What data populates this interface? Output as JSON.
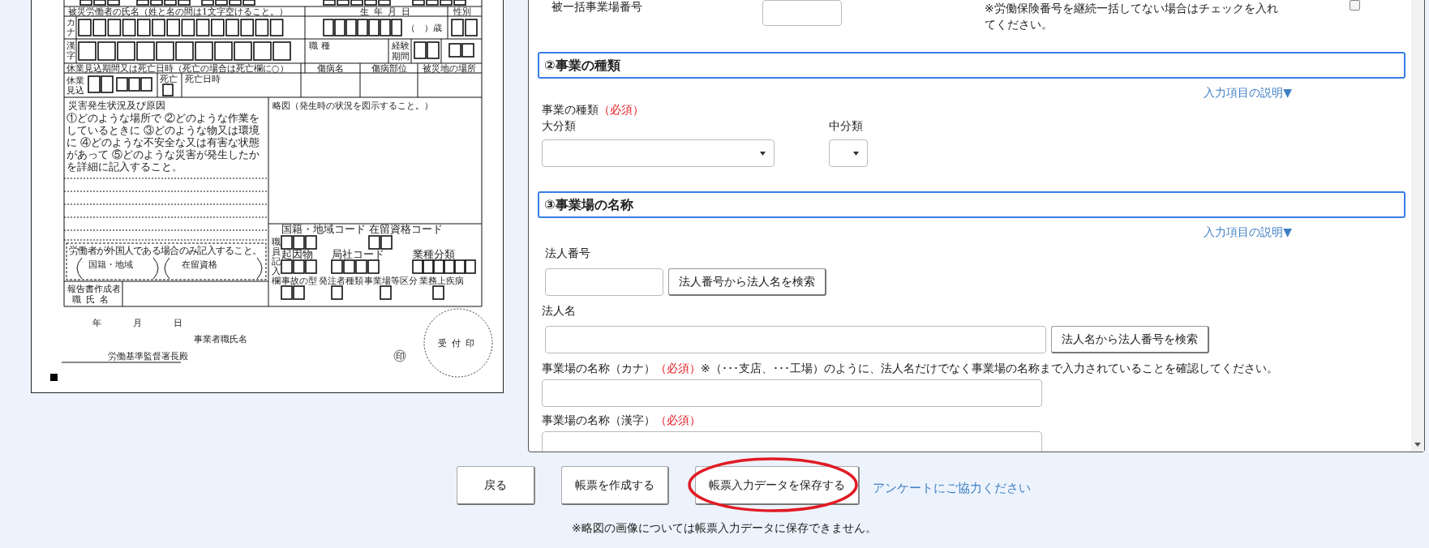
{
  "form_preview": {
    "name_header": "被災労働者の氏名（姓と名の間は1文字空けること。）",
    "birth_header": "生年月日",
    "sex_header": "性別",
    "kana_label": "カナ",
    "kanji_label": "漢字",
    "age_text": "（　）歳",
    "occupation_label": "職種",
    "experience_label": "経験期間",
    "absence_header": "休業見込期間又は死亡日時（死亡の場合は死亡欄に○）",
    "injury_header": "傷病名",
    "body_part_header": "傷病部位",
    "location_header": "被災地の場所",
    "absence_label": "休業見込",
    "death_label": "死亡",
    "death_time_label": "死亡日時",
    "cause_title": "災害発生状況及び原因",
    "cause_note": "①どのような場所で ②どのような作業をしているときに ③どのような物又は環境に ④どのような不安全な又は有害な状態があって ⑤どのような災害が発生したかを詳細に記入すること。",
    "sketch_title": "略図（発生時の状況を図示すること。）",
    "foreign_note": "労働者が外国人である場合のみ記入すること。",
    "nationality_label": "国籍・地域",
    "residence_label": "在留資格",
    "reporter_label": "報告書作成者職氏名",
    "office_label": "職員記入欄",
    "office_codes": [
      "国籍・地域コード",
      "在留資格コード",
      "起因物",
      "局社コード",
      "業種分類",
      "事故の型",
      "発注者種類",
      "事業場等区分",
      "業務上疾病"
    ],
    "date_labels": [
      "年",
      "月",
      "日"
    ],
    "employer_label": "事業者職氏名",
    "addressee": "労働基準監督署長殿",
    "seal": "印",
    "stamp": "受付印"
  },
  "form": {
    "top_row": {
      "label": "被一括事業場番号",
      "note": "※労働保険番号を継続一括してない場合はチェックを入れてください。",
      "checked": false
    },
    "business_type": {
      "title": "②事業の種類",
      "help_link": "入力項目の説明▼",
      "label": "事業の種類",
      "required": "（必須）",
      "major_label": "大分類",
      "minor_label": "中分類"
    },
    "workplace": {
      "title": "③事業場の名称",
      "help_link": "入力項目の説明▼",
      "corp_number_label": "法人番号",
      "corp_number_button": "法人番号から法人名を検索",
      "corp_name_label": "法人名",
      "corp_name_button": "法人名から法人番号を検索",
      "kana_label": "事業場の名称（カナ）",
      "kana_required": "（必須）",
      "kana_note": "※（･･･支店、･･･工場）のように、法人名だけでなく事業場の名称まで入力されていることを確認してください。",
      "kanji_label": "事業場の名称（漢字）",
      "kanji_required": "（必須）"
    }
  },
  "buttons": [
    {
      "label": "戻る",
      "circled": false
    },
    {
      "label": "帳票を作成する",
      "circled": false
    },
    {
      "label": "帳票入力データを保存する",
      "circled": true
    }
  ],
  "survey_link": "アンケートにご協力ください",
  "footnote": "※略図の画像については帳票入力データに保存できません。"
}
